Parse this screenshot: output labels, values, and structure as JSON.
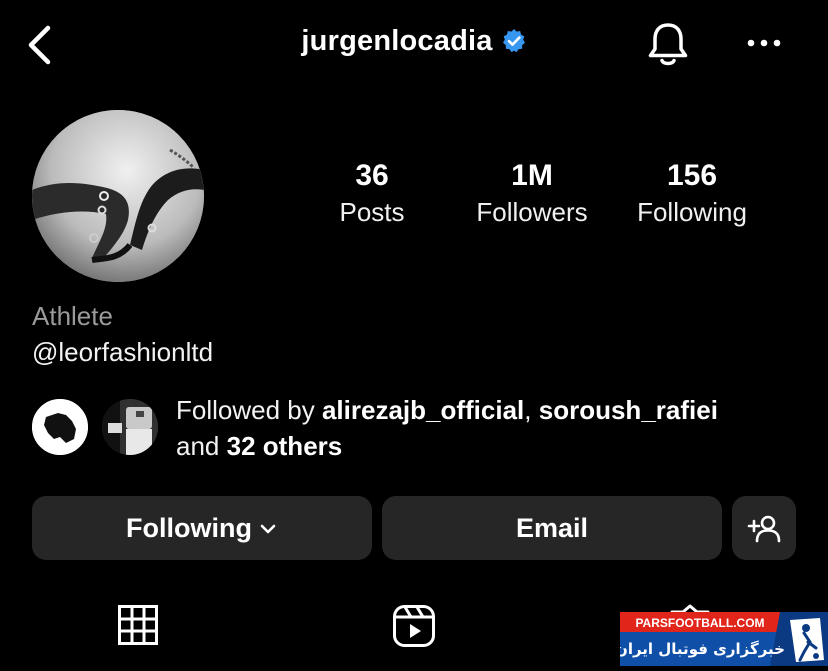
{
  "header": {
    "username": "jurgenlocadia",
    "verified": true,
    "icons": [
      "back-arrow-icon",
      "bell-icon",
      "more-dots-icon"
    ]
  },
  "stats": {
    "posts_count": "36",
    "posts_label": "Posts",
    "followers_count": "1M",
    "followers_label": "Followers",
    "following_count": "156",
    "following_label": "Following"
  },
  "bio": {
    "category": "Athlete",
    "handle": "@leorfashionltd"
  },
  "followed_by": {
    "prefix": "Followed by",
    "user1": "alirezajb_official",
    "separator": ",",
    "user2": "soroush_rafiei",
    "and": "and",
    "others": "32 others"
  },
  "actions": {
    "following_label": "Following",
    "email_label": "Email"
  },
  "tabs": [
    "grid-icon",
    "reels-icon",
    "tagged-icon"
  ],
  "watermark": {
    "site": "PARSFOOTBALL.COM",
    "tagline": "خبرگزاری فوتبال ایران"
  },
  "colors": {
    "background": "#000000",
    "button_bg": "#262626",
    "verified_blue": "#3797f0",
    "secondary_text": "#9a9a9a"
  }
}
